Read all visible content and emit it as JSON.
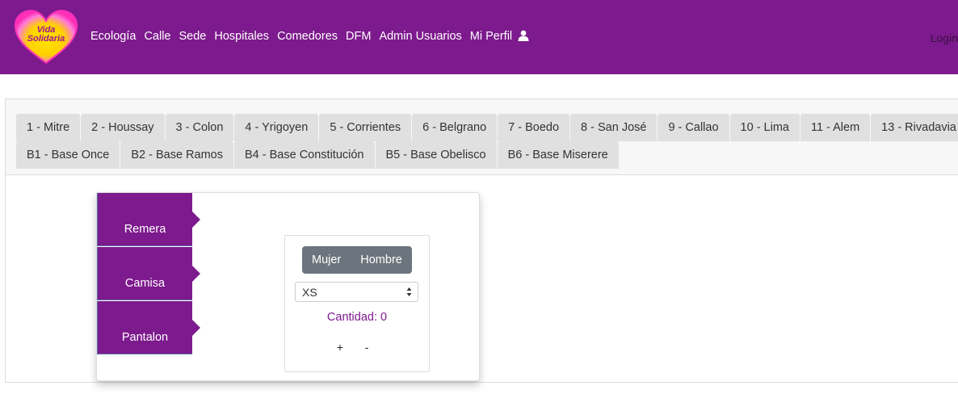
{
  "brand": {
    "logo_text_line1": "Vida",
    "logo_text_line2": "Solidaria",
    "heart_color": "#ff2fb8",
    "inner_color": "#ffe600"
  },
  "navbar": {
    "bg_color": "#7d1a8d",
    "links": [
      "Ecología",
      "Calle",
      "Sede",
      "Hospitales",
      "Comedores",
      "DFM",
      "Admin Usuarios",
      "Mi Perfil"
    ],
    "profile_icon": "user-icon",
    "login": "Login"
  },
  "bases": {
    "row1": [
      "1 - Mitre",
      "2 - Houssay",
      "3 - Colon",
      "4 - Yrigoyen",
      "5 - Corrientes",
      "6 - Belgrano",
      "7 - Boedo",
      "8 - San José",
      "9 - Callao",
      "10 - Lima",
      "11 - Alem",
      "13 - Rivadavia"
    ],
    "row2": [
      "B1 - Base Once",
      "B2 - Base Ramos",
      "B4 - Base Constitución",
      "B5 - Base Obelisco",
      "B6 - Base Miserere"
    ]
  },
  "garments": [
    "Remera",
    "Camisa",
    "Pantalon"
  ],
  "gender_buttons": {
    "mujer": "Mujer",
    "hombre": "Hombre"
  },
  "size_select": {
    "value": "XS"
  },
  "quantity": {
    "label": "Cantidad: 0",
    "plus": "+",
    "minus": "-"
  }
}
